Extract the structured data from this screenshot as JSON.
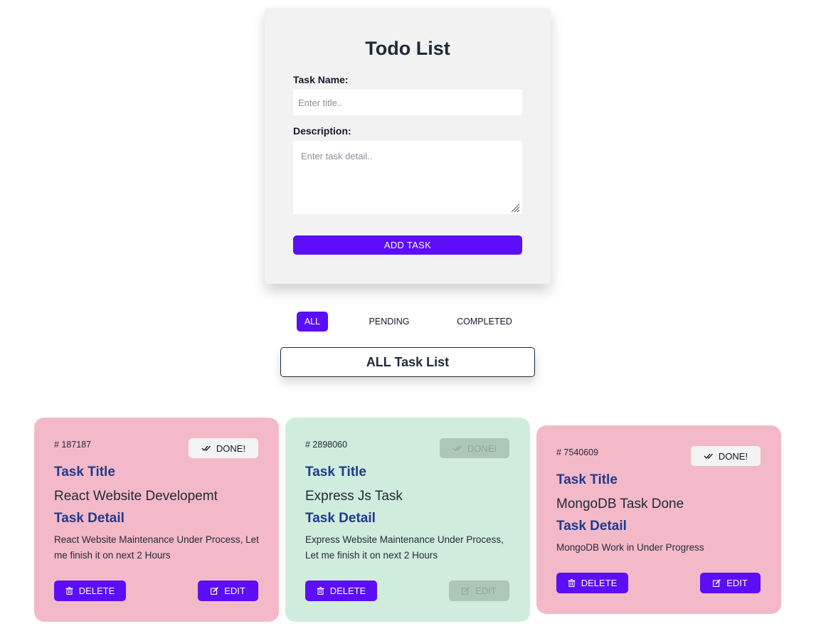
{
  "form": {
    "title": "Todo List",
    "task_name_label": "Task Name:",
    "task_name_placeholder": "Enter title..",
    "task_name_value": "",
    "description_label": "Description:",
    "description_placeholder": "Enter task detail..",
    "description_value": "",
    "add_button": "ADD TASK"
  },
  "filters": {
    "active": "ALL",
    "tabs": [
      "ALL",
      "PENDING",
      "COMPLETED"
    ]
  },
  "list_heading": "ALL Task List",
  "tasks": [
    {
      "id": "# 187187",
      "status": "pending",
      "done_label": "DONE!",
      "title_heading": "Task Title",
      "title": "React Website Developemt",
      "detail_heading": "Task Detail",
      "detail": "React Website Maintenance Under Process, Let me finish it on next 2 Hours",
      "delete_label": "DELETE",
      "edit_label": "EDIT",
      "color": "#f4b9c8"
    },
    {
      "id": "# 2898060",
      "status": "completed",
      "done_label": "DONE!",
      "title_heading": "Task Title",
      "title": "Express Js Task",
      "detail_heading": "Task Detail",
      "detail": "Express Website Maintenance Under Process, Let me finish it on next 2 Hours",
      "delete_label": "DELETE",
      "edit_label": "EDIT",
      "color": "#d0ecdc"
    },
    {
      "id": "# 7540609",
      "status": "pending",
      "done_label": "DONE!",
      "title_heading": "Task Title",
      "title": "MongoDB Task Done",
      "detail_heading": "Task Detail",
      "detail": "MongoDB Work in Under Progress",
      "delete_label": "DELETE",
      "edit_label": "EDIT",
      "color": "#f4b9c8"
    }
  ],
  "colors": {
    "accent": "#5b0ef7",
    "heading": "#1e3a8a",
    "pending_card": "#f4b9c8",
    "completed_card": "#d0ecdc",
    "disabled_button": "#acc6b8"
  },
  "icons": {
    "done": "double-check-icon",
    "delete": "trash-icon",
    "edit": "edit-square-icon",
    "resize": "resize-grip-icon"
  }
}
